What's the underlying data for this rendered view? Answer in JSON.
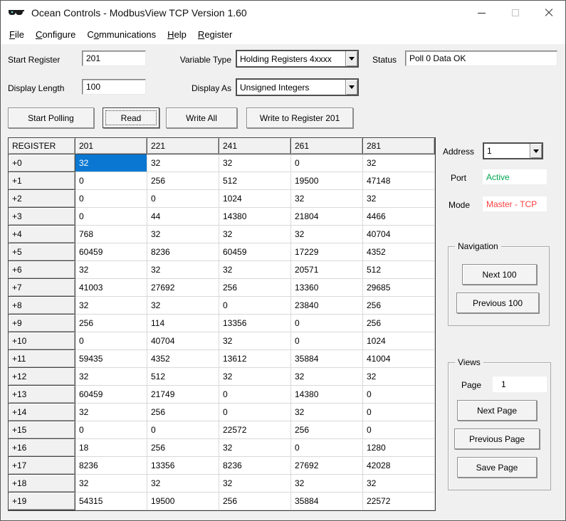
{
  "window": {
    "title": "Ocean Controls - ModbusView TCP Version 1.60"
  },
  "menu": {
    "items": [
      {
        "pre": "",
        "u": "F",
        "rest": "ile"
      },
      {
        "pre": "",
        "u": "C",
        "rest": "onfigure"
      },
      {
        "pre": "C",
        "u": "o",
        "rest": "mmunications"
      },
      {
        "pre": "",
        "u": "H",
        "rest": "elp"
      },
      {
        "pre": "",
        "u": "R",
        "rest": "egister"
      }
    ]
  },
  "form": {
    "start_register": {
      "label": "Start Register",
      "value": "201"
    },
    "variable_type": {
      "label": "Variable Type",
      "value": "Holding Registers 4xxxx"
    },
    "status": {
      "label": "Status",
      "value": "Poll 0 Data OK"
    },
    "display_length": {
      "label": "Display Length",
      "value": "100"
    },
    "display_as": {
      "label": "Display As",
      "value": "Unsigned Integers"
    }
  },
  "toolbar": {
    "start_polling": "Start Polling",
    "read": "Read",
    "write_all": "Write All",
    "write_to_register": "Write to Register 201"
  },
  "table": {
    "headers": [
      "REGISTER",
      "201",
      "221",
      "241",
      "261",
      "281"
    ],
    "rows": [
      {
        "label": "+0",
        "values": [
          "32",
          "32",
          "32",
          "0",
          "32"
        ]
      },
      {
        "label": "+1",
        "values": [
          "0",
          "256",
          "512",
          "19500",
          "47148"
        ]
      },
      {
        "label": "+2",
        "values": [
          "0",
          "0",
          "1024",
          "32",
          "32"
        ]
      },
      {
        "label": "+3",
        "values": [
          "0",
          "44",
          "14380",
          "21804",
          "4466"
        ]
      },
      {
        "label": "+4",
        "values": [
          "768",
          "32",
          "32",
          "32",
          "40704"
        ]
      },
      {
        "label": "+5",
        "values": [
          "60459",
          "8236",
          "60459",
          "17229",
          "4352"
        ]
      },
      {
        "label": "+6",
        "values": [
          "32",
          "32",
          "32",
          "20571",
          "512"
        ]
      },
      {
        "label": "+7",
        "values": [
          "41003",
          "27692",
          "256",
          "13360",
          "29685"
        ]
      },
      {
        "label": "+8",
        "values": [
          "32",
          "32",
          "0",
          "23840",
          "256"
        ]
      },
      {
        "label": "+9",
        "values": [
          "256",
          "114",
          "13356",
          "0",
          "256"
        ]
      },
      {
        "label": "+10",
        "values": [
          "0",
          "40704",
          "32",
          "0",
          "1024"
        ]
      },
      {
        "label": "+11",
        "values": [
          "59435",
          "4352",
          "13612",
          "35884",
          "41004"
        ]
      },
      {
        "label": "+12",
        "values": [
          "32",
          "512",
          "32",
          "32",
          "32"
        ]
      },
      {
        "label": "+13",
        "values": [
          "60459",
          "21749",
          "0",
          "14380",
          "0"
        ]
      },
      {
        "label": "+14",
        "values": [
          "32",
          "256",
          "0",
          "32",
          "0"
        ]
      },
      {
        "label": "+15",
        "values": [
          "0",
          "0",
          "22572",
          "256",
          "0"
        ]
      },
      {
        "label": "+16",
        "values": [
          "18",
          "256",
          "32",
          "0",
          "1280"
        ]
      },
      {
        "label": "+17",
        "values": [
          "8236",
          "13356",
          "8236",
          "27692",
          "42028"
        ]
      },
      {
        "label": "+18",
        "values": [
          "32",
          "32",
          "32",
          "32",
          "32"
        ]
      },
      {
        "label": "+19",
        "values": [
          "54315",
          "19500",
          "256",
          "35884",
          "22572"
        ]
      }
    ],
    "selected": {
      "row": 0,
      "col": 0
    }
  },
  "side": {
    "address": {
      "label": "Address",
      "value": "1"
    },
    "port": {
      "label": "Port",
      "value": "Active"
    },
    "mode": {
      "label": "Mode",
      "value": "Master - TCP"
    }
  },
  "navigation": {
    "title": "Navigation",
    "next": "Next 100",
    "previous": "Previous 100"
  },
  "views": {
    "title": "Views",
    "page_label": "Page",
    "page_value": "1",
    "next": "Next Page",
    "previous": "Previous Page",
    "save": "Save Page"
  },
  "colors": {
    "selection": "#0a78d2",
    "port-active": "#00a550",
    "mode-master": "#ff4040"
  }
}
